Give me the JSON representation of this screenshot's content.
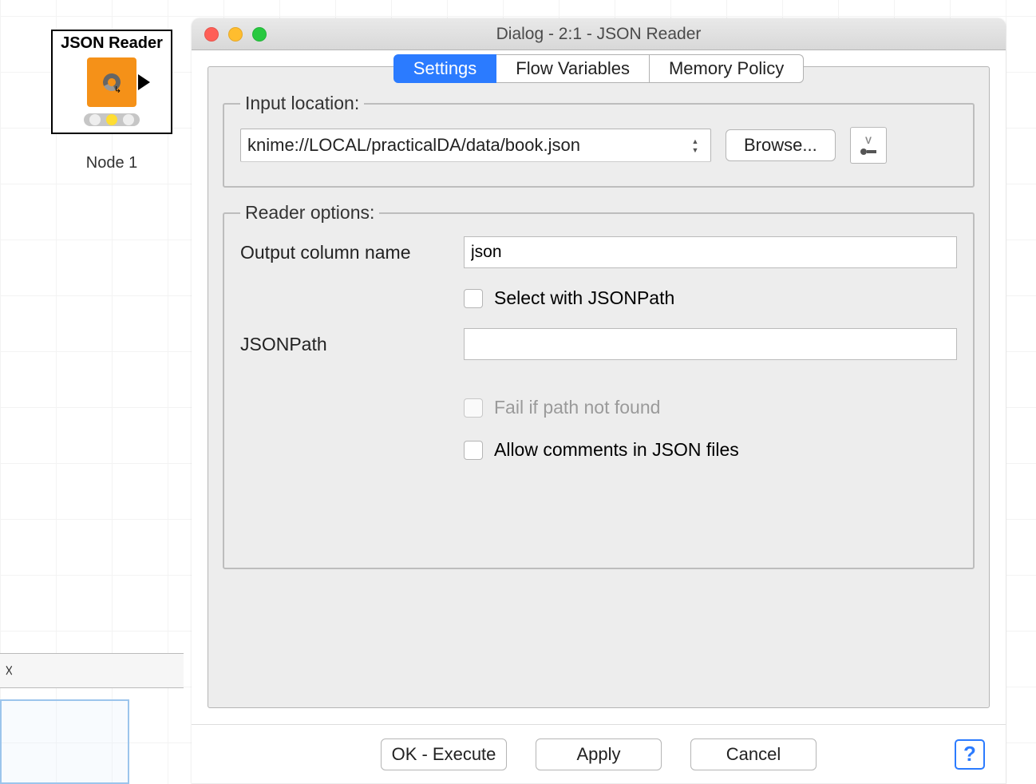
{
  "canvas": {
    "node_title": "JSON Reader",
    "node_label": "Node 1"
  },
  "dialog": {
    "title": "Dialog - 2:1 - JSON Reader",
    "tabs": {
      "settings": "Settings",
      "flow_variables": "Flow Variables",
      "memory_policy": "Memory Policy"
    },
    "input_location": {
      "legend": "Input location:",
      "path": "knime://LOCAL/practicalDA/data/book.json",
      "browse": "Browse..."
    },
    "reader_options": {
      "legend": "Reader options:",
      "output_column_label": "Output column name",
      "output_column_value": "json",
      "select_with_jsonpath": "Select with JSONPath",
      "jsonpath_label": "JSONPath",
      "jsonpath_value": "",
      "fail_if_not_found": "Fail if path not found",
      "allow_comments": "Allow comments in JSON files"
    },
    "buttons": {
      "ok": "OK - Execute",
      "apply": "Apply",
      "cancel": "Cancel"
    }
  }
}
